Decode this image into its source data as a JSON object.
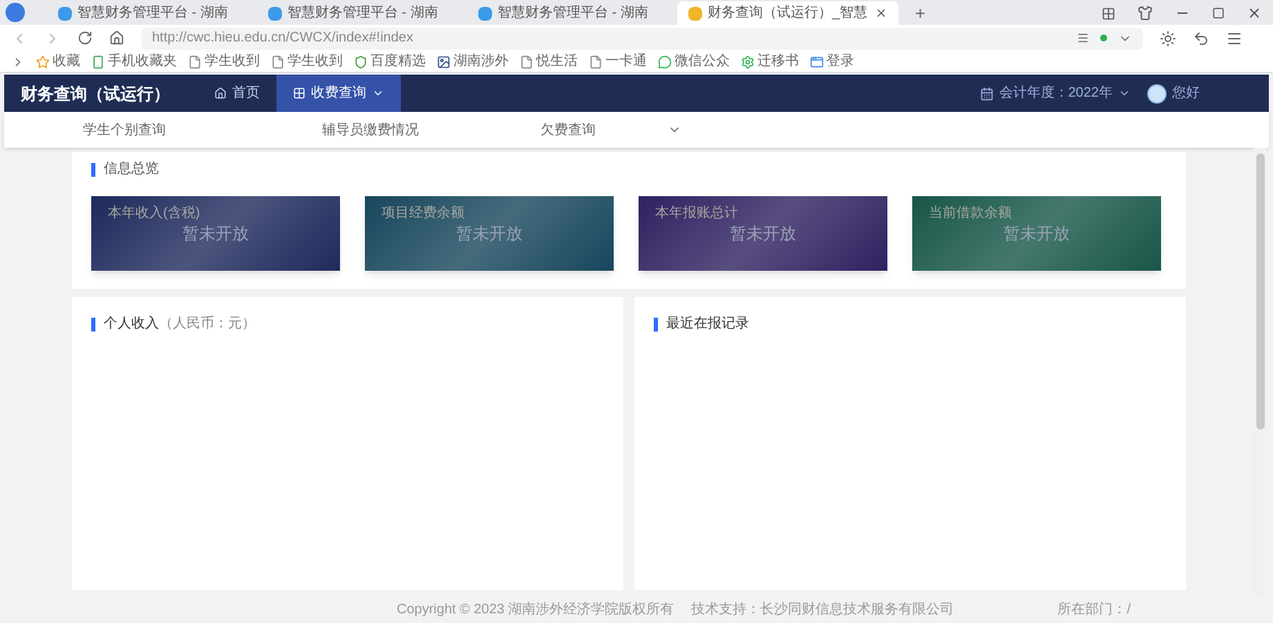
{
  "browser": {
    "tabs": [
      {
        "title": "智慧财务管理平台 - 湖南",
        "selected": false
      },
      {
        "title": "智慧财务管理平台 - 湖南",
        "selected": false
      },
      {
        "title": "智慧财务管理平台 - 湖南",
        "selected": false
      },
      {
        "title": "财务查询（试运行）_智慧",
        "selected": true
      }
    ],
    "new_tab": "+",
    "url": "http://cwc.hieu.edu.cn/CWCX/index#!index",
    "bookmarks": [
      {
        "label": "收藏",
        "kind": "star"
      },
      {
        "label": "手机收藏夹",
        "kind": "phone"
      },
      {
        "label": "学生收到",
        "kind": "page"
      },
      {
        "label": "学生收到",
        "kind": "page"
      },
      {
        "label": "百度精选",
        "kind": "shield"
      },
      {
        "label": "湖南涉外",
        "kind": "image"
      },
      {
        "label": "悦生活",
        "kind": "page"
      },
      {
        "label": "一卡通",
        "kind": "page"
      },
      {
        "label": "微信公众",
        "kind": "chat"
      },
      {
        "label": "迁移书",
        "kind": "gear"
      },
      {
        "label": "登录",
        "kind": "app"
      }
    ]
  },
  "app": {
    "title": "财务查询（试运行）",
    "nav": [
      {
        "label": "首页",
        "kind": "home",
        "selected": false
      },
      {
        "label": "收费查询",
        "kind": "menu",
        "selected": true
      }
    ],
    "fiscal_year": "会计年度：2022年",
    "greeting": "您好",
    "subnav": [
      {
        "label": "学生个别查询",
        "kind": "link"
      },
      {
        "label": "辅导员缴费情况",
        "kind": "link"
      },
      {
        "label": "欠费查询",
        "kind": "dropdown"
      }
    ]
  },
  "overview": {
    "title": "信息总览",
    "cards": [
      {
        "label": "本年收入(含税)",
        "value": "暂未开放",
        "color": "#1e2a5c"
      },
      {
        "label": "项目经费余额",
        "value": "暂未开放",
        "color": "#17465c"
      },
      {
        "label": "本年报账总计",
        "value": "暂未开放",
        "color": "#2f2160"
      },
      {
        "label": "当前借款余额",
        "value": "暂未开放",
        "color": "#175648"
      }
    ]
  },
  "income_panel": {
    "title": "个人收入",
    "unit": "（人民币：元）"
  },
  "records_panel": {
    "title": "最近在报记录"
  },
  "footer": {
    "copyright": "Copyright © 2023 湖南涉外经济学院版权所有",
    "support": "技术支持：长沙同财信息技术服务有限公司",
    "department": "所在部门：/"
  }
}
